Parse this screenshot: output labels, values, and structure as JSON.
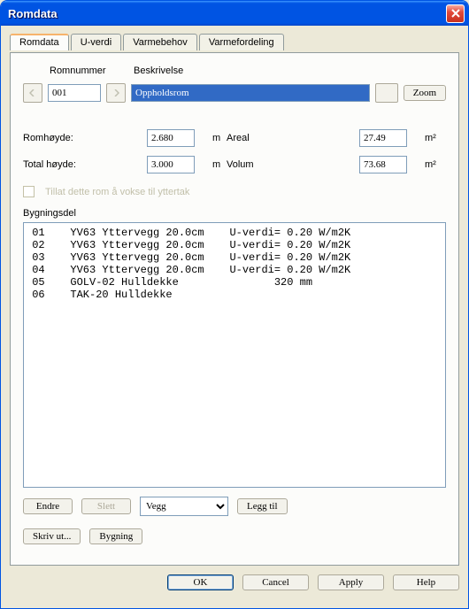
{
  "window": {
    "title": "Romdata"
  },
  "tabs": [
    "Romdata",
    "U-verdi",
    "Varmebehov",
    "Varmefordeling"
  ],
  "labels": {
    "romnummer": "Romnummer",
    "beskrivelse": "Beskrivelse",
    "romhoyde": "Romhøyde:",
    "totalhoyde": "Total høyde:",
    "areal": "Areal",
    "volum": "Volum",
    "tillat": "Tillat dette rom å vokse til yttertak",
    "bygningsdel": "Bygningsdel"
  },
  "values": {
    "romnummer": "001",
    "beskrivelse": "Oppholdsrom",
    "romhoyde": "2.680",
    "totalhoyde": "3.000",
    "areal": "27.49",
    "volum": "73.68"
  },
  "units": {
    "m": "m",
    "m2": "m²"
  },
  "list": [
    " 01    YV63 Yttervegg 20.0cm    U-verdi= 0.20 W/m2K",
    " 02    YV63 Yttervegg 20.0cm    U-verdi= 0.20 W/m2K",
    " 03    YV63 Yttervegg 20.0cm    U-verdi= 0.20 W/m2K",
    " 04    YV63 Yttervegg 20.0cm    U-verdi= 0.20 W/m2K",
    " 05    GOLV-02 Hulldekke               320 mm",
    " 06    TAK-20 Hulldekke"
  ],
  "typeSelect": {
    "selected": "Vegg"
  },
  "buttons": {
    "zoom": "Zoom",
    "endre": "Endre",
    "slett": "Slett",
    "legg_til": "Legg til",
    "skriv_ut": "Skriv ut...",
    "bygning": "Bygning",
    "ok": "OK",
    "cancel": "Cancel",
    "apply": "Apply",
    "help": "Help"
  }
}
